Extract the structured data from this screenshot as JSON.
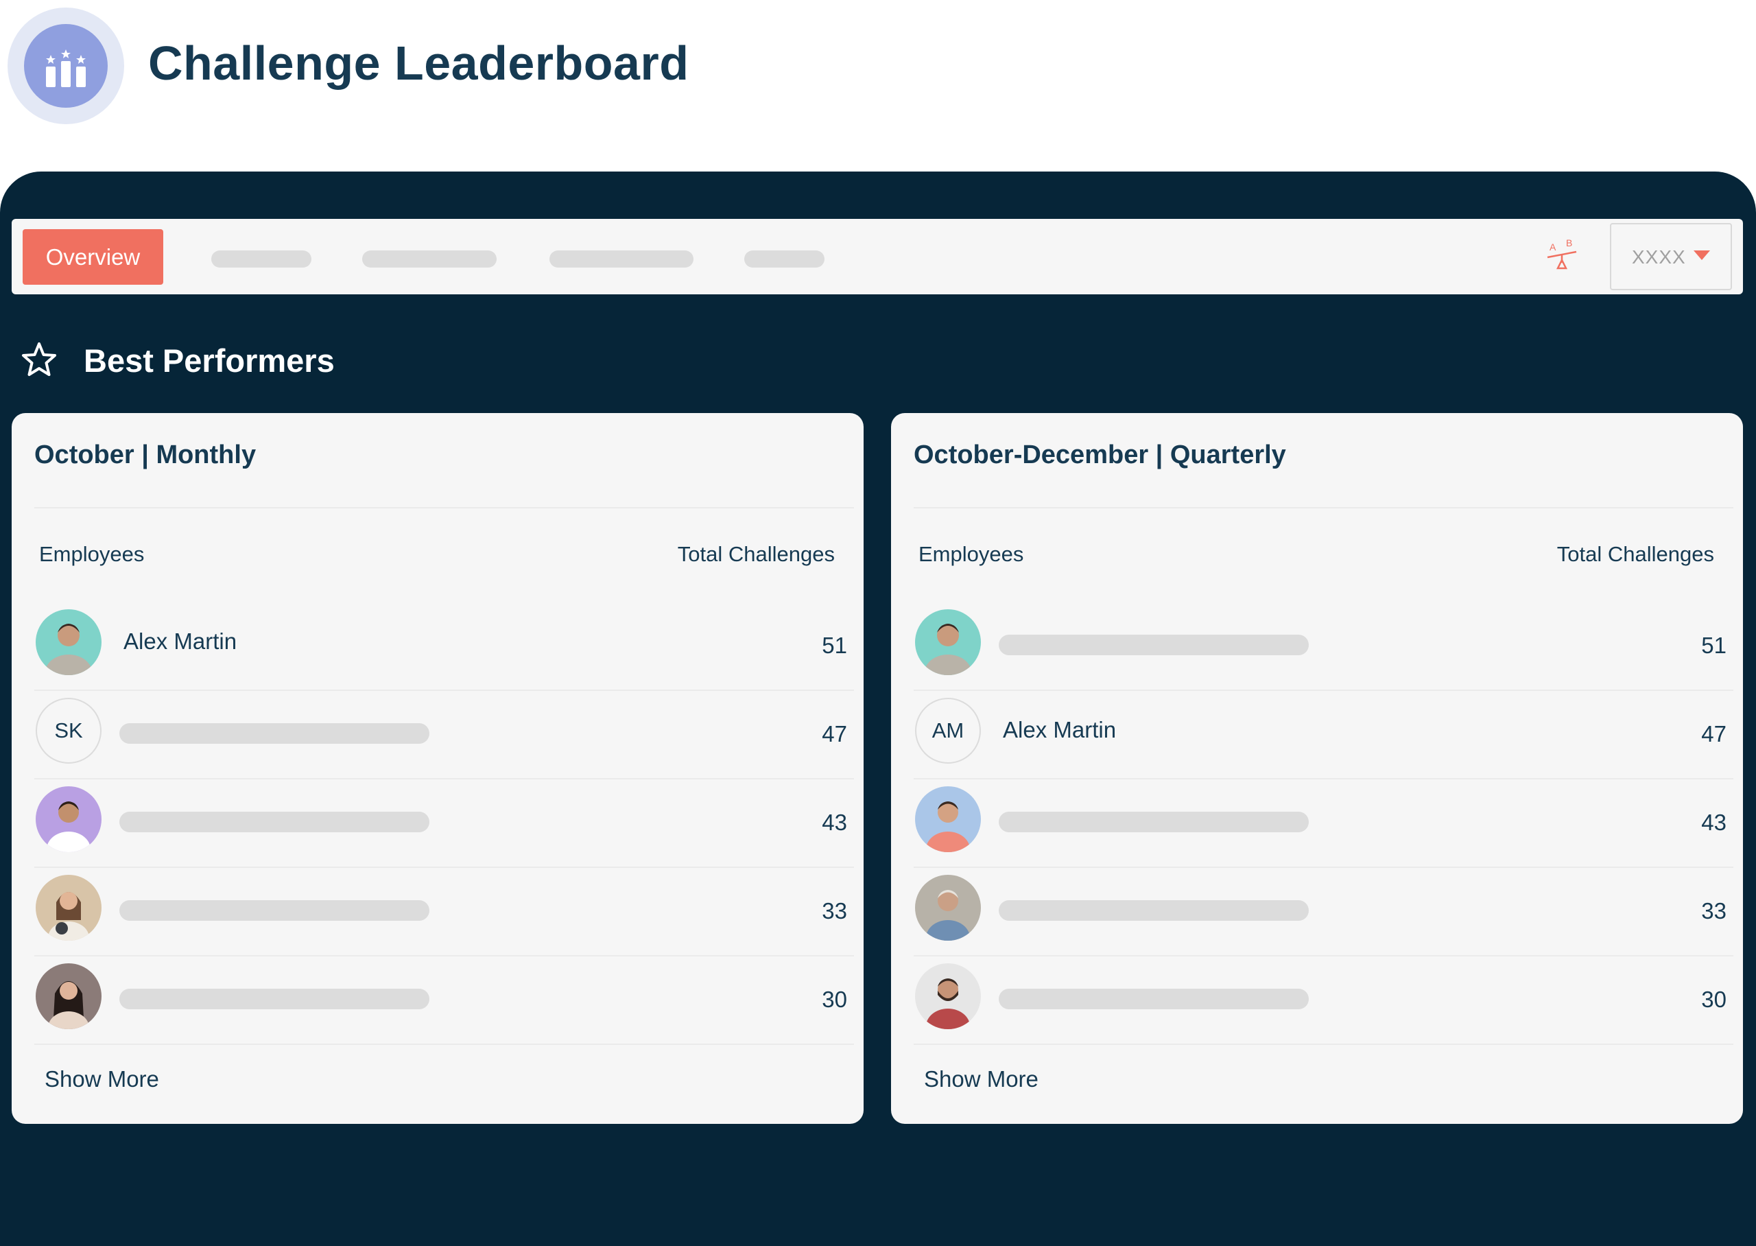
{
  "header": {
    "title": "Challenge Leaderboard",
    "logo_icon": "podium-icon"
  },
  "toolbar": {
    "tabs": [
      {
        "label": "Overview",
        "active": true
      },
      {
        "label": "",
        "placeholder": true
      },
      {
        "label": "",
        "placeholder": true
      },
      {
        "label": "",
        "placeholder": true
      },
      {
        "label": "",
        "placeholder": true
      }
    ],
    "translate_icon": "ab-balance-icon",
    "select": {
      "value": "XXXX",
      "caret_icon": "caret-down-icon"
    }
  },
  "section": {
    "icon": "star-outline-icon",
    "title": "Best Performers"
  },
  "cards": [
    {
      "title": "October | Monthly",
      "col_employees": "Employees",
      "col_total": "Total Challenges",
      "rows": [
        {
          "name": "Alex Martin",
          "score": "51",
          "avatar": "photo",
          "avatar_bg": "#7fd3c9"
        },
        {
          "name": "",
          "initials": "SK",
          "score": "47",
          "avatar": "initials"
        },
        {
          "name": "",
          "score": "43",
          "avatar": "photo",
          "avatar_bg": "#b9a0e3"
        },
        {
          "name": "",
          "score": "33",
          "avatar": "photo",
          "avatar_bg": "#d8c4a8"
        },
        {
          "name": "",
          "score": "30",
          "avatar": "photo",
          "avatar_bg": "#8b7b78"
        }
      ],
      "show_more": "Show More"
    },
    {
      "title": "October-December | Quarterly",
      "col_employees": "Employees",
      "col_total": "Total Challenges",
      "rows": [
        {
          "name": "",
          "score": "51",
          "avatar": "photo",
          "avatar_bg": "#7fd3c9"
        },
        {
          "name": "Alex Martin",
          "initials": "AM",
          "score": "47",
          "avatar": "initials"
        },
        {
          "name": "",
          "score": "43",
          "avatar": "photo",
          "avatar_bg": "#aac6e8"
        },
        {
          "name": "",
          "score": "33",
          "avatar": "photo",
          "avatar_bg": "#b7b2a8"
        },
        {
          "name": "",
          "score": "30",
          "avatar": "photo",
          "avatar_bg": "#e6e6e6"
        }
      ],
      "show_more": "Show More"
    }
  ],
  "colors": {
    "dark_panel": "#062538",
    "accent": "#f07060",
    "title_text": "#163a52",
    "logo_blue": "#8f9fdf"
  }
}
